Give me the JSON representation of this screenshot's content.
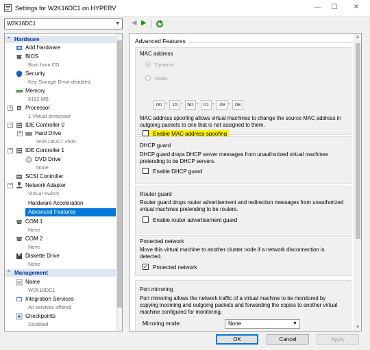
{
  "window": {
    "title": "Settings for W2K16DC1 on HYPERV",
    "minimize": "—",
    "maximize": "☐",
    "close": "✕"
  },
  "vm_selector": {
    "value": "W2K16DC1"
  },
  "tree": {
    "hardware_header": "Hardware",
    "management_header": "Management",
    "items": {
      "add_hardware": "Add Hardware",
      "bios": "BIOS",
      "bios_sub": "Boot from CD",
      "security": "Security",
      "security_sub": "Key Storage Drive disabled",
      "memory": "Memory",
      "memory_sub": "8192 MB",
      "processor": "Processor",
      "processor_sub": "1 Virtual processor",
      "ide0": "IDE Controller 0",
      "hard_drive": "Hard Drive",
      "hard_drive_sub": "W2K16DC1.vhdx",
      "ide1": "IDE Controller 1",
      "dvd": "DVD Drive",
      "dvd_sub": "None",
      "scsi": "SCSI Controller",
      "network": "Network Adapter",
      "network_sub": "Virtual Switch",
      "hw_accel": "Hardware Acceleration",
      "adv_features": "Advanced Features",
      "com1": "COM 1",
      "com1_sub": "None",
      "com2": "COM 2",
      "com2_sub": "None",
      "diskette": "Diskette Drive",
      "diskette_sub": "None",
      "name": "Name",
      "name_sub": "W2K16DC1",
      "integration": "Integration Services",
      "integration_sub": "All services offered",
      "checkpoints": "Checkpoints",
      "checkpoints_sub": "Disabled"
    }
  },
  "panel": {
    "title": "Advanced Features",
    "mac": {
      "title": "MAC address",
      "dynamic": "Dynamic",
      "static": "Static",
      "octets": [
        "00",
        "15",
        "5D",
        "01",
        "39",
        "08"
      ],
      "desc": "MAC address spoofing allows virtual machines to change the source MAC address in outgoing packets to one that is not assigned to them.",
      "spoofing_label": "Enable MAC address spoofing",
      "spoofing_checked": false
    },
    "dhcp": {
      "title": "DHCP guard",
      "desc": "DHCP guard drops DHCP server messages from unauthorized virtual machines pretending to be DHCP servers.",
      "label": "Enable DHCP guard"
    },
    "router": {
      "title": "Router guard",
      "desc": "Router guard drops router advertisement and redirection messages from unauthorized virtual machines pretending to be routers.",
      "label": "Enable router advertisement guard"
    },
    "protected": {
      "title": "Protected network",
      "desc": "Move this virtual machine to another cluster node if a network disconnection is detected.",
      "label": "Protected network",
      "checked_mark": "✓"
    },
    "mirroring": {
      "title": "Port mirroring",
      "desc": "Port mirroring allows the network traffic of a virtual machine to be monitored by copying incoming and outgoing packets and forwarding the copies to another virtual machine configured for monitoring.",
      "mode_label": "Mirroring mode:",
      "mode_value": "None"
    }
  },
  "buttons": {
    "ok": "OK",
    "cancel": "Cancel",
    "apply": "Apply"
  },
  "colors": {
    "selection": "#0078d7",
    "highlight": "#fff200",
    "section_text": "#003399"
  }
}
